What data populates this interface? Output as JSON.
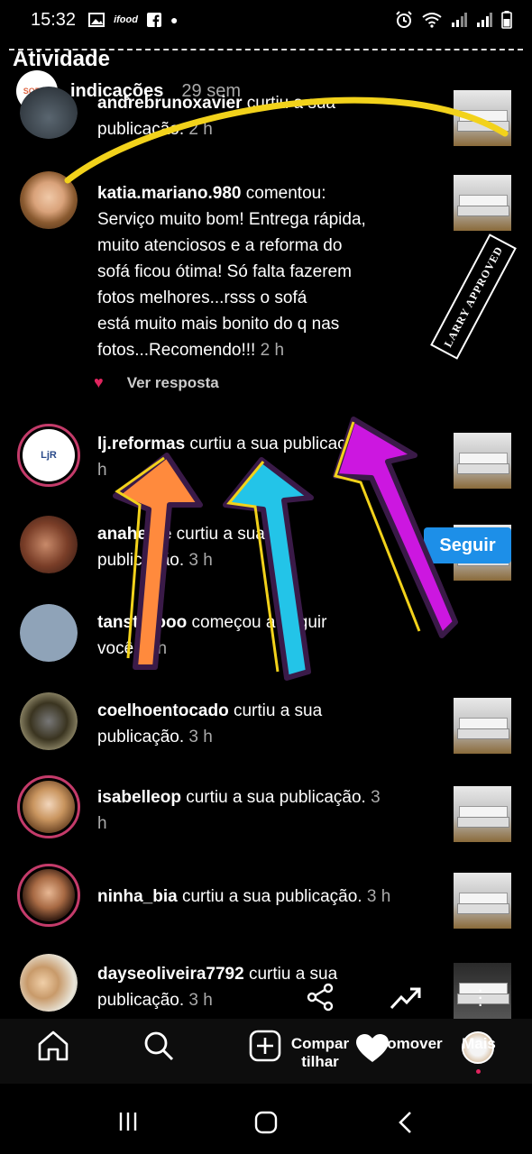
{
  "status_bar": {
    "time": "15:32",
    "left_icons": [
      "image-icon",
      "ifood-icon",
      "facebook-icon",
      "dot-icon"
    ],
    "ifood_label": "ifood",
    "right_icons": [
      "alarm-icon",
      "wifi-icon",
      "signal-icon",
      "signal-icon",
      "battery-icon"
    ]
  },
  "header": {
    "title": "Atividade",
    "ind_avatar_text": "SOFAS",
    "ind_label": "indicações",
    "ind_time": "29 sem"
  },
  "activity": [
    {
      "user": "andrebrunoxavier",
      "action": "curtiu a sua publicação.",
      "time": "2 h"
    },
    {
      "user": "katia.mariano.980",
      "action": "comentou: Serviço muito bom! Entrega rápida, muito atenciosos e a reforma do sofá ficou ótima! Só falta fazerem fotos melhores...rsss o sofá está muito mais bonito do q nas fotos...Recomendo!!!",
      "time": "2 h"
    },
    {
      "user": "lj.reformas",
      "action": "curtiu a sua publicação.",
      "time": "3 h"
    },
    {
      "user": "anaheide",
      "action": "curtiu a sua publicação.",
      "time": "3 h"
    },
    {
      "user": "tanstroooo",
      "action": "começou a seguir você.",
      "time": "3 h"
    },
    {
      "user": "coelhoentocado",
      "action": "curtiu a sua publicação.",
      "time": "3 h"
    },
    {
      "user": "isabelleop",
      "action": "curtiu a sua publicação.",
      "time": "3 h"
    },
    {
      "user": "ninha_bia",
      "action": "curtiu a sua publicação.",
      "time": "3 h"
    },
    {
      "user": "dayseoliveira7792",
      "action": "curtiu a sua publicação.",
      "time": "3 h"
    }
  ],
  "visible_text": {
    "row0": {
      "user": "andrebrunoxavier",
      "action": " curtiu a sua",
      "line2": "publicação.",
      "time": " 2 h"
    },
    "row1": {
      "user": "katia.mariano.980",
      "l1": " comentou:",
      "l2": "Serviço muito bom! Entrega rápida,",
      "l3": "muito atenciosos e a reforma do",
      "l4": "sofá ficou ótima! Só falta fazerem",
      "l5": "fotos melhores...rsss o sofá",
      "l6": "está muito mais bonito do q nas",
      "l7": "fotos...Recomendo!!!",
      "time": " 2 h"
    },
    "row2": {
      "user": "lj.reformas",
      "action": " curtiu a sua publicação.",
      "time": " 3",
      "time2": "h",
      "avatar_text": "LjR"
    },
    "row3": {
      "user": "anaheide",
      "action": " curtiu a sua",
      "line2": "publicação.",
      "time": " 3 h"
    },
    "row4": {
      "user": "tanstroooo",
      "action": " começou a seguir",
      "line2": "você.",
      "time": " 3 h"
    },
    "row5": {
      "user": "coelhoentocado",
      "action": " curtiu a sua",
      "line2": "publicação.",
      "time": " 3 h"
    },
    "row6": {
      "user": "isabelleop",
      "action": " curtiu a sua publicação.",
      "time": " 3",
      "time2": "h"
    },
    "row7": {
      "user": "ninha_bia",
      "action": " curtiu a sua publicação.",
      "time": " 3 h"
    },
    "row8": {
      "user": "dayseoliveira7792",
      "action": " curtiu a sua",
      "line2": "publicação.",
      "time": " 3 h"
    }
  },
  "reply": {
    "label": "Ver resposta"
  },
  "follow_button": {
    "label": "Seguir"
  },
  "stamp": {
    "text": "LARRY APPROVED"
  },
  "bottom_nav": {
    "share_label_1": "Compar",
    "share_label_2": "tilhar",
    "promote_label": "Promover",
    "more_label": "Mais"
  },
  "colors": {
    "background": "#000000",
    "follow_button": "#1d8fe8",
    "heart": "#e0245e",
    "story_ring": "#c43b6a",
    "arrow_orange": "#ff8a3d",
    "arrow_cyan": "#23c4e8",
    "arrow_magenta": "#cc17e0",
    "scribble_yellow": "#f2d21b"
  }
}
